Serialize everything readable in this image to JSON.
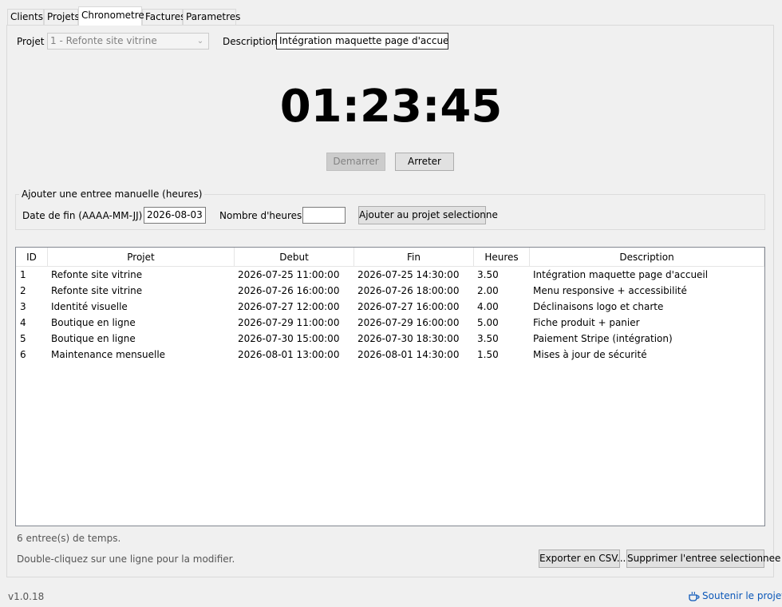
{
  "tabs": [
    "Clients",
    "Projets",
    "Chronometre",
    "Factures",
    "Parametres"
  ],
  "active_tab": "Chronometre",
  "form": {
    "project_label": "Projet",
    "project_value": "1 - Refonte site vitrine",
    "description_label": "Description",
    "description_value": "Intégration maquette page d'accueil"
  },
  "timer": {
    "display": "01:23:45"
  },
  "buttons": {
    "start": "Demarrer",
    "stop": "Arreter"
  },
  "manual_entry": {
    "title": "Ajouter une entree manuelle (heures)",
    "end_date_label": "Date de fin (AAAA-MM-JJ)",
    "end_date_value": "2026-08-03",
    "hours_label": "Nombre d'heures",
    "hours_value": "",
    "add_button": "Ajouter au projet selectionne"
  },
  "table": {
    "columns": [
      "ID",
      "Projet",
      "Debut",
      "Fin",
      "Heures",
      "Description"
    ],
    "rows": [
      [
        "1",
        "Refonte site vitrine",
        "2026-07-25 11:00:00",
        "2026-07-25 14:30:00",
        "3.50",
        "Intégration maquette page d'accueil"
      ],
      [
        "2",
        "Refonte site vitrine",
        "2026-07-26 16:00:00",
        "2026-07-26 18:00:00",
        "2.00",
        "Menu responsive + accessibilité"
      ],
      [
        "3",
        "Identité visuelle",
        "2026-07-27 12:00:00",
        "2026-07-27 16:00:00",
        "4.00",
        "Déclinaisons logo et charte"
      ],
      [
        "4",
        "Boutique en ligne",
        "2026-07-29 11:00:00",
        "2026-07-29 16:00:00",
        "5.00",
        "Fiche produit + panier"
      ],
      [
        "5",
        "Boutique en ligne",
        "2026-07-30 15:00:00",
        "2026-07-30 18:30:00",
        "3.50",
        "Paiement Stripe (intégration)"
      ],
      [
        "6",
        "Maintenance mensuelle",
        "2026-08-01 13:00:00",
        "2026-08-01 14:30:00",
        "1.50",
        "Mises à jour de sécurité"
      ]
    ]
  },
  "footer": {
    "count_text": "6 entree(s) de temps.",
    "hint_text": "Double-cliquez sur une ligne pour la modifier.",
    "export_button": "Exporter en CSV...",
    "delete_button": "Supprimer l'entree selectionnee"
  },
  "status": {
    "version": "v1.0.18",
    "support_link": "Soutenir le projet"
  },
  "icons": {
    "combo_arrow": "chevron-down-icon",
    "support": "coffee-cup-icon"
  },
  "colors": {
    "link": "#0b57b8",
    "tab_active_bg": "#ffffff",
    "window_bg": "#f0f0f0"
  }
}
